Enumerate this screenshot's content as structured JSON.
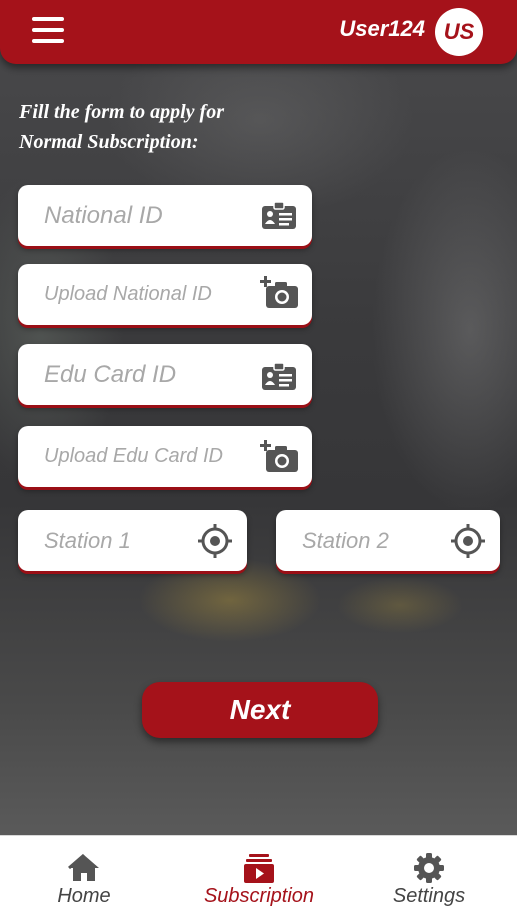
{
  "header": {
    "username": "User124",
    "avatar_initials": "US"
  },
  "intro": {
    "line1": "Fill the form to apply for",
    "line2": "Normal Subscription:"
  },
  "form": {
    "national_id": {
      "placeholder": "National ID",
      "icon": "id-card-icon"
    },
    "upload_national_id": {
      "placeholder": "Upload National ID",
      "icon": "add-photo-icon"
    },
    "edu_card_id": {
      "placeholder": "Edu Card ID",
      "icon": "id-card-icon"
    },
    "upload_edu_card_id": {
      "placeholder": "Upload Edu Card ID",
      "icon": "add-photo-icon"
    },
    "station1": {
      "placeholder": "Station 1",
      "icon": "crosshair-icon"
    },
    "station2": {
      "placeholder": "Station 2",
      "icon": "crosshair-icon"
    },
    "next_label": "Next"
  },
  "bottom_nav": {
    "home": {
      "label": "Home",
      "icon": "home-icon"
    },
    "subscription": {
      "label": "Subscription",
      "icon": "subscription-icon",
      "active": true
    },
    "settings": {
      "label": "Settings",
      "icon": "gear-icon"
    }
  },
  "colors": {
    "brand": "#a5121a",
    "icon_gray": "#555555",
    "placeholder": "#a8a8a8"
  }
}
